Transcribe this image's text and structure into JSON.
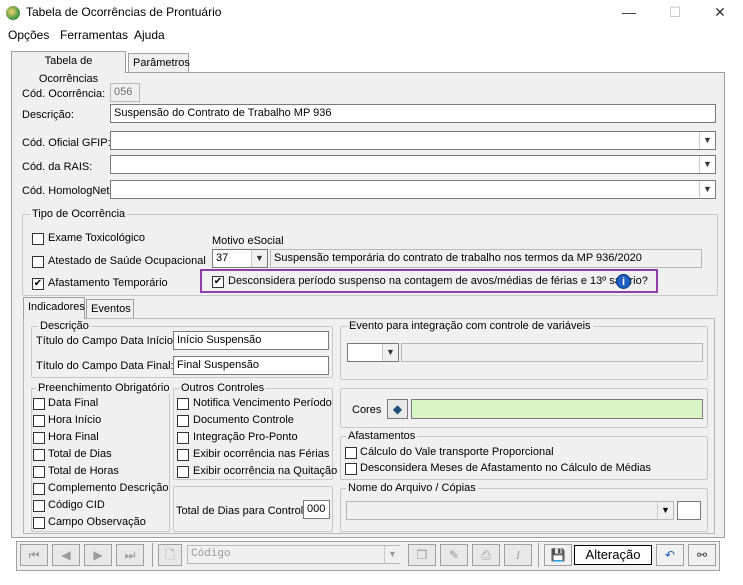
{
  "window": {
    "title": "Tabela de Ocorrências de Prontuário",
    "minimize": "—",
    "maximize": "☐",
    "close": "✕"
  },
  "menu": [
    "Opções",
    "Ferramentas",
    "Ajuda"
  ],
  "tabs": [
    "Tabela de Ocorrências",
    "Parâmetros"
  ],
  "form": {
    "cod_ocorrencia_label": "Cód. Ocorrência:",
    "cod_ocorrencia_value": "056",
    "descricao_label": "Descrição:",
    "descricao_value": "Suspensão do Contrato de Trabalho MP 936",
    "gfip_label": "Cód. Oficial GFIP:",
    "rais_label": "Cód. da RAIS:",
    "homolognet_label": "Cód. HomologNet:"
  },
  "tipo": {
    "title": "Tipo de Ocorrência",
    "exame": "Exame Toxicológico",
    "atestado": "Atestado de Saúde Ocupacional",
    "afastamento": "Afastamento Temporário",
    "motivo_label": "Motivo eSocial",
    "motivo_code": "37",
    "motivo_desc": "Suspensão temporária do contrato de trabalho nos termos da MP 936/2020",
    "desconsidera": "Desconsidera período suspenso na contagem de avos/médias de férias e 13º salário?",
    "info_icon": "i"
  },
  "subtabs": [
    "Indicadores",
    "Eventos"
  ],
  "descricao_group": {
    "title": "Descrição",
    "inicio_label": "Título do Campo Data Início:",
    "inicio_value": "Início Suspensão",
    "final_label": "Título do Campo Data Final:",
    "final_value": "Final Suspensão"
  },
  "evento_group": {
    "title": "Evento para integração com controle de variáveis"
  },
  "preenchimento": {
    "title": "Preenchimento Obrigatório",
    "items": [
      "Data Final",
      "Hora Início",
      "Hora Final",
      "Total de Dias",
      "Total de Horas",
      "Complemento Descrição",
      "Código CID",
      "Campo Observação"
    ]
  },
  "outros": {
    "title": "Outros Controles",
    "items": [
      "Notifica Vencimento Período",
      "Documento Controle",
      "Integração Pro-Ponto",
      "Exibir ocorrência nas Férias",
      "Exibir ocorrência na Quitação"
    ],
    "total_label": "Total de Dias para Controle:",
    "total_value": "000"
  },
  "cores": {
    "label": "Cores",
    "color": "#d9f5c5"
  },
  "afastamentos": {
    "title": "Afastamentos",
    "items": [
      "Cálculo do Vale transporte Proporcional",
      "Desconsidera Meses de Afastamento no Cálculo de Médias"
    ]
  },
  "arquivo": {
    "title": "Nome do Arquivo / Cópias"
  },
  "toolbar": {
    "codigo_placeholder": "Código",
    "mode": "Alteração"
  },
  "colors": {
    "highlight_border": "#8e3ea7",
    "info_blue": "#1f5fbf"
  }
}
